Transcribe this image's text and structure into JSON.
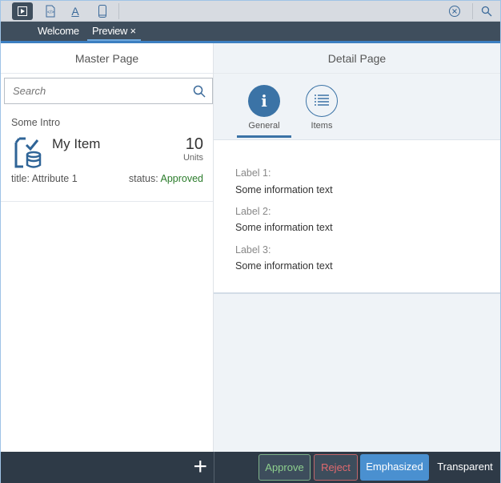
{
  "toolbar": {
    "icons": [
      "run-icon",
      "code-file-icon",
      "text-format-icon",
      "mobile-icon",
      "close-circle-icon",
      "search-icon"
    ]
  },
  "tabs": [
    {
      "label": "Welcome"
    },
    {
      "label": "Preview",
      "close": "×"
    }
  ],
  "master": {
    "title": "Master Page",
    "search_placeholder": "Search",
    "intro": "Some Intro",
    "item": {
      "title": "My Item",
      "number": "10",
      "unit": "Units",
      "attribute": "title: Attribute 1",
      "status_label": "status:",
      "status": "Approved"
    },
    "add": "+"
  },
  "detail": {
    "title": "Detail Page",
    "tabs": [
      {
        "label": "General"
      },
      {
        "label": "Items"
      }
    ],
    "fields": [
      {
        "label": "Label 1:",
        "value": "Some information text"
      },
      {
        "label": "Label 2:",
        "value": "Some information text"
      },
      {
        "label": "Label 3:",
        "value": "Some information text"
      }
    ]
  },
  "footer": {
    "approve": "Approve",
    "reject": "Reject",
    "emphasized": "Emphasized",
    "transparent": "Transparent"
  },
  "colors": {
    "accent": "#3c7fc1",
    "approved": "#2b7c2b",
    "reject": "#e0696e",
    "approve": "#8ed08e"
  }
}
